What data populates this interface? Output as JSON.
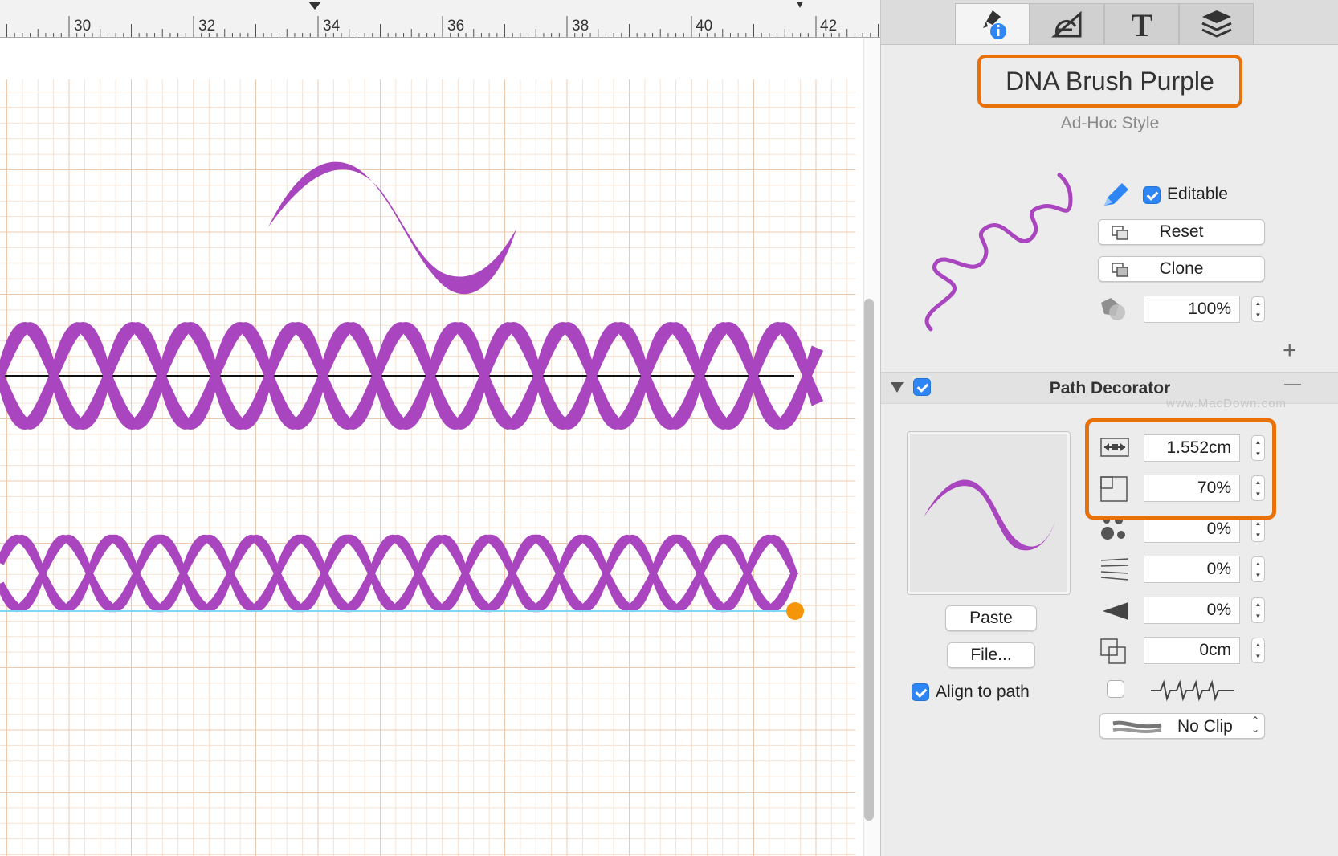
{
  "ruler": {
    "labels": [
      "30",
      "32",
      "34",
      "36",
      "38",
      "40",
      "42"
    ]
  },
  "inspector": {
    "tabs": [
      {
        "name": "style-inspector",
        "icon": "brush-info-icon"
      },
      {
        "name": "properties-inspector",
        "icon": "protractor-icon"
      },
      {
        "name": "text-inspector",
        "icon": "text-T-icon"
      },
      {
        "name": "layers-inspector",
        "icon": "layers-icon"
      }
    ],
    "style_name": "DNA Brush Purple",
    "style_kind": "Ad-Hoc Style",
    "editable_label": "Editable",
    "editable_checked": true,
    "reset_label": "Reset",
    "clone_label": "Clone",
    "opacity_value": "100%",
    "add_symbol": "+",
    "section": {
      "title": "Path Decorator",
      "enabled": true,
      "remove_symbol": "—",
      "watermark": "www.MacDown.com"
    },
    "decorator": {
      "paste_label": "Paste",
      "file_label": "File...",
      "align_label": "Align to path",
      "align_checked": true,
      "params": [
        {
          "name": "width",
          "icon": "width-arrows-icon",
          "value": "1.552cm"
        },
        {
          "name": "scale",
          "icon": "scale-square-icon",
          "value": "70%"
        },
        {
          "name": "scatter",
          "icon": "scatter-dots-icon",
          "value": "0%"
        },
        {
          "name": "spread",
          "icon": "spread-lines-icon",
          "value": "0%"
        },
        {
          "name": "taper",
          "icon": "taper-triangle-icon",
          "value": "0%"
        },
        {
          "name": "offset",
          "icon": "offset-squares-icon",
          "value": "0cm"
        }
      ],
      "jitter_checked": false,
      "clip_label": "No Clip"
    }
  },
  "colors": {
    "stroke_purple": "#a945be",
    "highlight_orange": "#e8710a",
    "accent_blue": "#2e86f5",
    "guide_cyan": "#7fd6f5",
    "endpoint_orange": "#f5960a",
    "grid_major": "#ecc9ad",
    "grid_minor": "#f6e3d3"
  }
}
